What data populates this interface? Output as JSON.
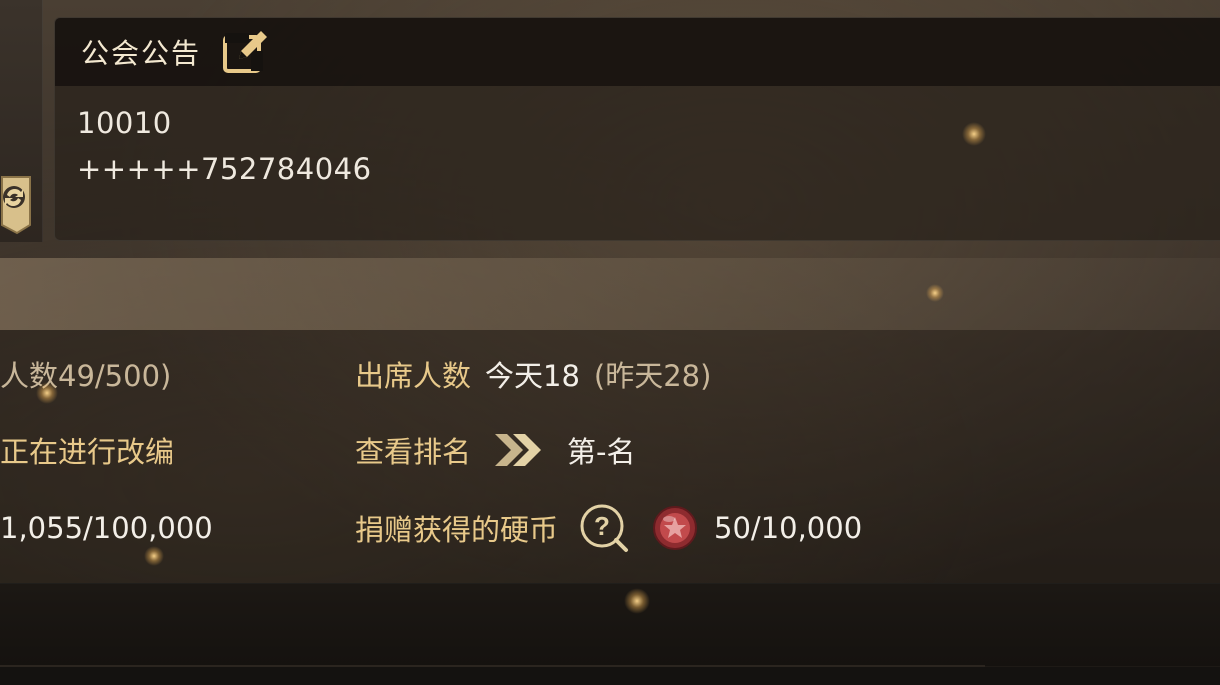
{
  "notice": {
    "title": "公会公告",
    "lines": [
      "10010",
      "+++++752784046"
    ]
  },
  "stats": {
    "members": "人数49/500)",
    "attendance_label": "出席人数",
    "attendance_today": "今天18",
    "attendance_yesterday": "(昨天28)",
    "status": "正在进行改编",
    "ranking_label": "查看排名",
    "ranking_value": "第-名",
    "funds": "1,055/100,000",
    "donation_label": "捐赠获得的硬币",
    "donation_value": "50/10,000"
  },
  "icons": {
    "side": "guild-swap-icon",
    "edit": "edit-icon",
    "ranking": "double-chevron-right-icon",
    "help": "question-magnifier-icon",
    "coin": "red-coin-icon"
  },
  "colors": {
    "gold_text": "#e8c98a",
    "white_text": "#f3efe8",
    "coin_red": "#b4373a"
  }
}
